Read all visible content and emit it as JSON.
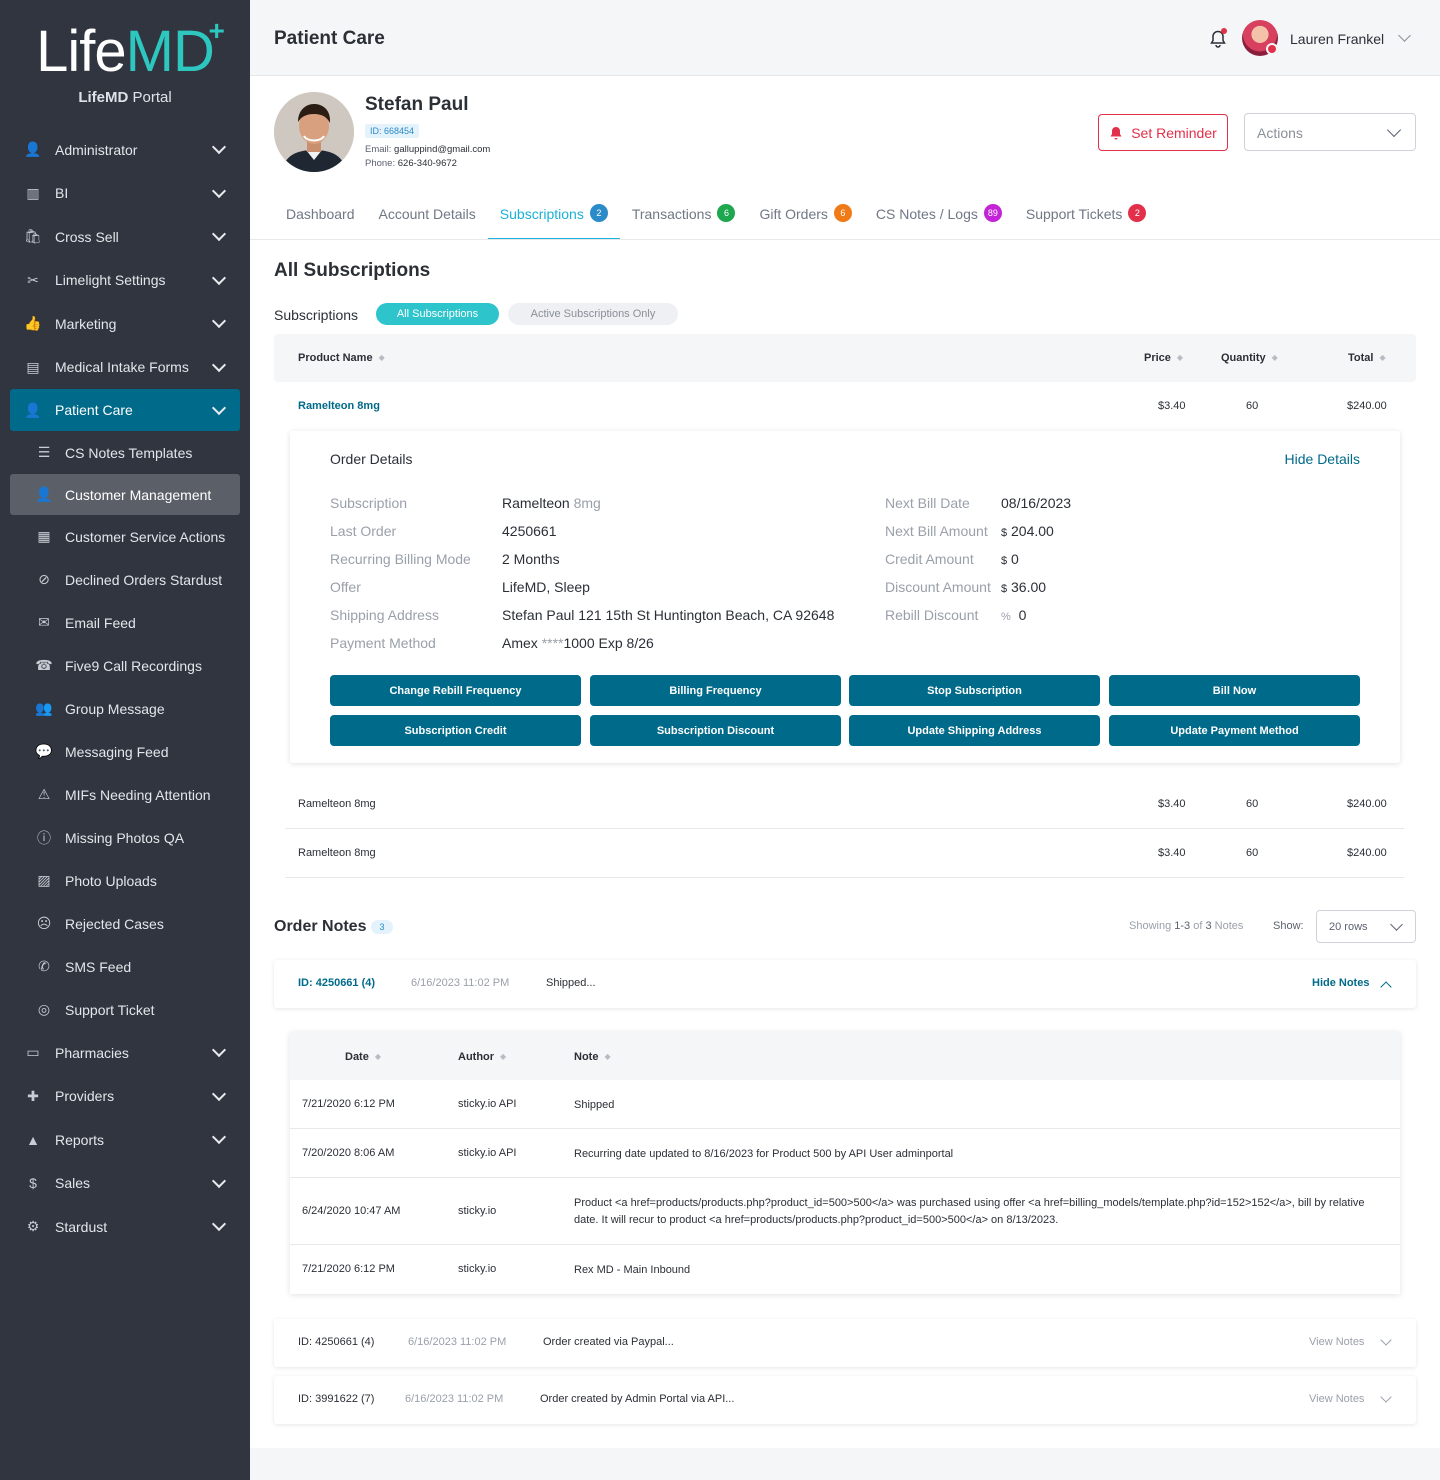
{
  "brand": {
    "life": "Life",
    "md": "MD",
    "plus": "+",
    "portal_bold": "LifeMD",
    "portal_rest": " Portal"
  },
  "sidebar": {
    "items": [
      {
        "label": "Administrator",
        "icon": "user-tie-icon",
        "expand": true
      },
      {
        "label": "BI",
        "icon": "books-icon",
        "expand": true
      },
      {
        "label": "Cross Sell",
        "icon": "shopping-bag-icon",
        "expand": true
      },
      {
        "label": "Limelight Settings",
        "icon": "tools-icon",
        "expand": true
      },
      {
        "label": "Marketing",
        "icon": "thumbs-up-icon",
        "expand": true
      },
      {
        "label": "Medical Intake Forms",
        "icon": "intake-form-icon",
        "expand": true
      },
      {
        "label": "Patient Care",
        "icon": "user-tie-icon",
        "expand": true,
        "active": true
      },
      {
        "label": "CS Notes Templates",
        "icon": "list-icon",
        "sub": true
      },
      {
        "label": "Customer Management",
        "icon": "customer-icon",
        "sub": true,
        "selected": true
      },
      {
        "label": "Customer Service Actions",
        "icon": "table-icon",
        "sub": true
      },
      {
        "label": "Declined Orders Stardust",
        "icon": "ban-icon",
        "sub": true
      },
      {
        "label": "Email Feed",
        "icon": "envelope-icon",
        "sub": true
      },
      {
        "label": "Five9 Call Recordings",
        "icon": "call-recording-icon",
        "sub": true
      },
      {
        "label": "Group Message",
        "icon": "group-icon",
        "sub": true
      },
      {
        "label": "Messaging Feed",
        "icon": "chat-icon",
        "sub": true
      },
      {
        "label": "MIFs Needing Attention",
        "icon": "warning-icon",
        "sub": true
      },
      {
        "label": "Missing Photos QA",
        "icon": "exclamation-circle-icon",
        "sub": true
      },
      {
        "label": "Photo Uploads",
        "icon": "image-icon",
        "sub": true
      },
      {
        "label": "Rejected Cases",
        "icon": "frown-icon",
        "sub": true
      },
      {
        "label": "SMS Feed",
        "icon": "phone-icon",
        "sub": true
      },
      {
        "label": "Support Ticket",
        "icon": "life-ring-icon",
        "sub": true
      },
      {
        "label": "Pharmacies",
        "icon": "store-icon",
        "expand": true
      },
      {
        "label": "Providers",
        "icon": "first-aid-icon",
        "expand": true
      },
      {
        "label": "Reports",
        "icon": "chart-area-icon",
        "expand": true
      },
      {
        "label": "Sales",
        "icon": "dollar-circle-icon",
        "expand": true
      },
      {
        "label": "Stardust",
        "icon": "cog-icon",
        "expand": true
      }
    ]
  },
  "header": {
    "title": "Patient Care",
    "user_name": "Lauren Frankel"
  },
  "patient": {
    "name": "Stefan Paul",
    "id_label": "ID: 668454",
    "email_label": "Email:",
    "email": "galluppind@gmail.com",
    "phone_label": "Phone:",
    "phone": "626-340-9672"
  },
  "buttons": {
    "set_reminder": "Set Reminder",
    "actions": "Actions"
  },
  "tabs": [
    {
      "label": "Dashboard"
    },
    {
      "label": "Account Details"
    },
    {
      "label": "Subscriptions",
      "badge": "2",
      "color": "#2a8bc8",
      "active": true
    },
    {
      "label": "Transactions",
      "badge": "6",
      "color": "#1fa750"
    },
    {
      "label": "Gift Orders",
      "badge": "6",
      "color": "#f07a18"
    },
    {
      "label": "CS Notes / Logs",
      "badge": "89",
      "color": "#c424d8"
    },
    {
      "label": "Support Tickets",
      "badge": "2",
      "color": "#e3304a"
    }
  ],
  "subscriptions": {
    "title": "All Subscriptions",
    "filter_label": "Subscriptions",
    "filter_all": "All Subscriptions",
    "filter_active": "Active Subscriptions Only",
    "columns": {
      "product": "Product Name",
      "price": "Price",
      "quantity": "Quantity",
      "total": "Total"
    },
    "rows": [
      {
        "product": "Ramelteon 8mg",
        "price": "$3.40",
        "quantity": "60",
        "total": "$240.00"
      },
      {
        "product": "Ramelteon 8mg",
        "price": "$3.40",
        "quantity": "60",
        "total": "$240.00"
      },
      {
        "product": "Ramelteon 8mg",
        "price": "$3.40",
        "quantity": "60",
        "total": "$240.00"
      }
    ]
  },
  "order_details": {
    "title": "Order Details",
    "hide": "Hide Details",
    "left": [
      {
        "label": "Subscription",
        "value": "Ramelteon",
        "muted": "8mg"
      },
      {
        "label": "Last Order",
        "value": "4250661"
      },
      {
        "label": "Recurring Billing Mode",
        "value": "2 Months"
      },
      {
        "label": "Offer",
        "value": "LifeMD, Sleep"
      },
      {
        "label": "Shipping Address",
        "value": "Stefan Paul 121 15th St Huntington Beach, CA 92648"
      },
      {
        "label": "Payment Method",
        "value": "Amex",
        "muted": "****",
        "value2": "1000 Exp 8/26"
      }
    ],
    "right": [
      {
        "label": "Next Bill Date",
        "value": "08/16/2023"
      },
      {
        "label": "Next Bill Amount",
        "muted": "$",
        "value": "204.00"
      },
      {
        "label": "Credit Amount",
        "muted": "$",
        "value": "0"
      },
      {
        "label": "Discount Amount",
        "muted": "$",
        "value": "36.00"
      },
      {
        "label": "Rebill Discount",
        "muted": "%",
        "value": "0"
      }
    ],
    "actions": [
      "Change Rebill Frequency",
      "Billing Frequency",
      "Stop Subscription",
      "Bill Now",
      "Subscription Credit",
      "Subscription Discount",
      "Update Shipping Address",
      "Update Payment Method"
    ]
  },
  "order_notes": {
    "title": "Order Notes",
    "count": "3",
    "showing_pre": "Showing ",
    "showing_range": "1-3",
    "showing_mid": " of ",
    "showing_total": "3",
    "showing_post": " Notes",
    "show_label": "Show:",
    "rows_option": "20 rows",
    "cards": [
      {
        "id": "ID: 4250661 (4)",
        "date": "6/16/2023 11:02 PM",
        "text": "Shipped...",
        "action": "Hide Notes",
        "open": true
      },
      {
        "id": "ID: 4250661 (4)",
        "date": "6/16/2023 11:02 PM",
        "text": "Order created via Paypal...",
        "action": "View Notes"
      },
      {
        "id": "ID: 3991622 (7)",
        "date": "6/16/2023 11:02 PM",
        "text": "Order created by Admin Portal via API...",
        "action": "View Notes"
      }
    ],
    "table": {
      "columns": {
        "date": "Date",
        "author": "Author",
        "note": "Note"
      },
      "rows": [
        {
          "date": "7/21/2020 6:12 PM",
          "author": "sticky.io API",
          "note": "Shipped"
        },
        {
          "date": "7/20/2020 8:06 AM",
          "author": "sticky.io API",
          "note": "Recurring date updated to 8/16/2023 for Product 500 by API User adminportal"
        },
        {
          "date": "6/24/2020 10:47 AM",
          "author": "sticky.io",
          "note": "Product <a href=products/products.php?product_id=500>500</a> was purchased using offer <a href=billing_models/template.php?id=152>152</a>, bill by relative date. It will recur to product <a href=products/products.php?product_id=500>500</a> on 8/13/2023."
        },
        {
          "date": "7/21/2020 6:12 PM",
          "author": "sticky.io",
          "note": "Rex MD - Main Inbound"
        }
      ]
    }
  }
}
